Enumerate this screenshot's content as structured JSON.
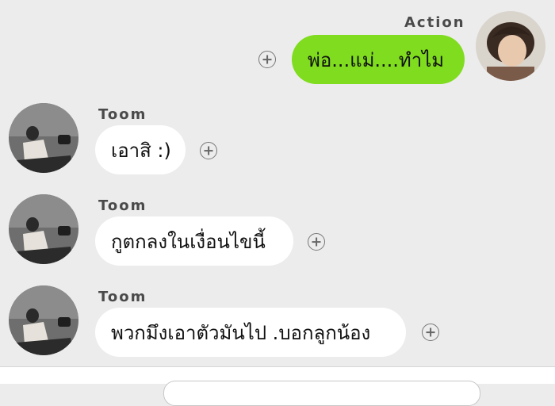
{
  "messages": [
    {
      "sender": "Action",
      "text": "พ่อ...แม่....ทำไม",
      "direction": "outgoing",
      "bubble_color": "#7fdc1e",
      "avatar": "profile-photo"
    },
    {
      "sender": "Toom",
      "text": "เอาสิ :)",
      "direction": "incoming",
      "bubble_color": "#ffffff",
      "avatar": "profile-photo"
    },
    {
      "sender": "Toom",
      "text": "กูตกลงในเงื่อนไขนี้",
      "direction": "incoming",
      "bubble_color": "#ffffff",
      "avatar": "profile-photo"
    },
    {
      "sender": "Toom",
      "text": "พวกมึงเอาตัวมันไป .บอกลูกน้อง",
      "direction": "incoming",
      "bubble_color": "#ffffff",
      "avatar": "profile-photo"
    }
  ],
  "icons": {
    "add_reaction": "plus-circle-icon"
  },
  "colors": {
    "background": "#ececec",
    "outgoing_bubble": "#7fdc1e",
    "incoming_bubble": "#ffffff"
  }
}
